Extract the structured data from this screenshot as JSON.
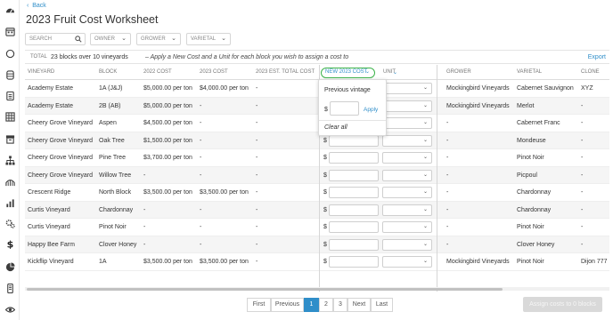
{
  "back_label": "Back",
  "page_title": "2023 Fruit Cost Worksheet",
  "filters": {
    "search_placeholder": "SEARCH",
    "owner": "OWNER",
    "grower": "GROWER",
    "varietal": "VARIETAL"
  },
  "summary": {
    "total_label": "TOTAL",
    "count_text": "23 blocks over 10 vineyards",
    "hint": "–  Apply a New Cost and a Unit for each block you wish to assign a cost to",
    "export_label": "Export"
  },
  "columns": {
    "vineyard": "VINEYARD",
    "block": "BLOCK",
    "cost_2022": "2022 COST",
    "cost_2023": "2023 COST",
    "est_total": "2023 EST. TOTAL COST",
    "new_cost": "NEW 2023 COST",
    "unit": "UNIT",
    "grower": "GROWER",
    "varietal": "VARIETAL",
    "clone": "CLONE"
  },
  "rows": [
    {
      "vineyard": "Academy Estate",
      "block": "1A (J&J)",
      "cost_2022": "$5,000.00 per ton",
      "cost_2023": "$4,000.00 per ton",
      "est_total": "-",
      "grower": "Mockingbird Vineyards",
      "varietal": "Cabernet Sauvignon",
      "clone": "XYZ"
    },
    {
      "vineyard": "Academy Estate",
      "block": "2B (AB)",
      "cost_2022": "$5,000.00 per ton",
      "cost_2023": "-",
      "est_total": "-",
      "grower": "Mockingbird Vineyards",
      "varietal": "Merlot",
      "clone": "-"
    },
    {
      "vineyard": "Cheery Grove Vineyard",
      "block": "Aspen",
      "cost_2022": "$4,500.00 per ton",
      "cost_2023": "-",
      "est_total": "-",
      "grower": "-",
      "varietal": "Cabernet Franc",
      "clone": "-"
    },
    {
      "vineyard": "Cheery Grove Vineyard",
      "block": "Oak Tree",
      "cost_2022": "$1,500.00 per ton",
      "cost_2023": "-",
      "est_total": "-",
      "grower": "-",
      "varietal": "Mondeuse",
      "clone": "-"
    },
    {
      "vineyard": "Cheery Grove Vineyard",
      "block": "Pine Tree",
      "cost_2022": "$3,700.00 per ton",
      "cost_2023": "-",
      "est_total": "-",
      "grower": "-",
      "varietal": "Pinot Noir",
      "clone": "-"
    },
    {
      "vineyard": "Cheery Grove Vineyard",
      "block": "Willow Tree",
      "cost_2022": "-",
      "cost_2023": "-",
      "est_total": "-",
      "grower": "-",
      "varietal": "Picpoul",
      "clone": "-"
    },
    {
      "vineyard": "Crescent Ridge",
      "block": "North Block",
      "cost_2022": "$3,500.00 per ton",
      "cost_2023": "$3,500.00 per ton",
      "est_total": "-",
      "grower": "-",
      "varietal": "Chardonnay",
      "clone": "-"
    },
    {
      "vineyard": "Curtis Vineyard",
      "block": "Chardonnay",
      "cost_2022": "-",
      "cost_2023": "-",
      "est_total": "-",
      "grower": "-",
      "varietal": "Chardonnay",
      "clone": "-"
    },
    {
      "vineyard": "Curtis Vineyard",
      "block": "Pinot Noir",
      "cost_2022": "-",
      "cost_2023": "-",
      "est_total": "-",
      "grower": "-",
      "varietal": "Pinot Noir",
      "clone": "-"
    },
    {
      "vineyard": "Happy Bee Farm",
      "block": "Clover Honey",
      "cost_2022": "-",
      "cost_2023": "-",
      "est_total": "-",
      "grower": "-",
      "varietal": "Clover Honey",
      "clone": "-"
    },
    {
      "vineyard": "Kickflip Vineyard",
      "block": "1A",
      "cost_2022": "$3,500.00 per ton",
      "cost_2023": "$3,500.00 per ton",
      "est_total": "-",
      "grower": "Mockingbird Vineyards",
      "varietal": "Pinot Noir",
      "clone": "Dijon 777"
    }
  ],
  "dollar_sign": "$",
  "popup": {
    "previous_vintage": "Previous vintage",
    "dollar_sign": "$",
    "apply_label": "Apply",
    "clear_all_label": "Clear all"
  },
  "pagination": {
    "first": "First",
    "previous": "Previous",
    "pages": [
      "1",
      "2",
      "3"
    ],
    "next": "Next",
    "last": "Last"
  },
  "assign_button": "Assign costs to 0 blocks",
  "colors": {
    "accent": "#2f8ec9",
    "highlight_ring": "#3cb34a",
    "disabled_button": "#d9d9d9"
  },
  "sidebar_icons": [
    "dashboard-icon",
    "calendar-icon",
    "circle-icon",
    "barrel-icon",
    "clipboard-icon",
    "grid-icon",
    "archive-icon",
    "hierarchy-icon",
    "vineyard-icon",
    "bar-chart-icon",
    "gears-icon",
    "dollar-icon",
    "pie-chart-icon",
    "mobile-icon",
    "eye-icon"
  ]
}
